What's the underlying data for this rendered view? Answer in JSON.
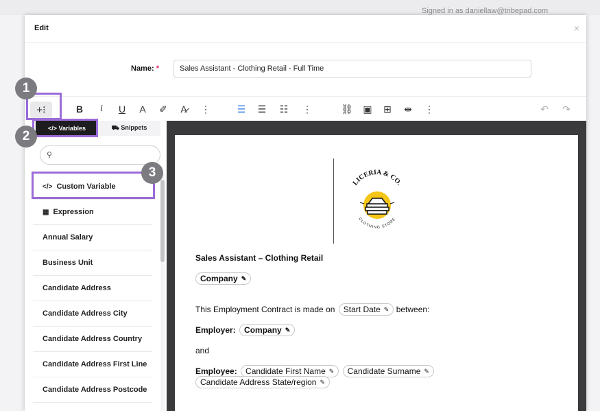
{
  "background": {
    "ghost_text": "Signed in as daniellaw@tribepad.com"
  },
  "modal": {
    "title": "Edit",
    "close_glyph": "×"
  },
  "form": {
    "name_label": "Name:",
    "required_mark": "*",
    "name_value": "Sales Assistant - Clothing Retail - Full Time"
  },
  "toolbar": {
    "insert": "+⁝",
    "bold": "B",
    "italic": "i",
    "underline": "U",
    "text_color": "A",
    "highlight": "✐",
    "clear_format": "A̷",
    "more1": "⋮",
    "align_left": "☰",
    "align_center": "☰",
    "list": "☷",
    "more2": "⋮",
    "link": "⛓",
    "image": "▣",
    "table": "⊞",
    "columns": "⇹",
    "more3": "⋮",
    "undo": "↶",
    "redo": "↷"
  },
  "sidebar": {
    "tabs": [
      {
        "label": "</> Variables"
      },
      {
        "label": "⛟ Snippets"
      }
    ],
    "search_icon": "search-icon",
    "search_glyph": "⚲",
    "items": [
      {
        "icon": "</>",
        "label": "Custom Variable"
      },
      {
        "icon": "▦",
        "label": "Expression"
      },
      {
        "icon": "",
        "label": "Annual Salary"
      },
      {
        "icon": "",
        "label": "Business Unit"
      },
      {
        "icon": "",
        "label": "Candidate Address"
      },
      {
        "icon": "",
        "label": "Candidate Address City"
      },
      {
        "icon": "",
        "label": "Candidate Address Country"
      },
      {
        "icon": "",
        "label": "Candidate Address First Line"
      },
      {
        "icon": "",
        "label": "Candidate Address Postcode"
      }
    ]
  },
  "document": {
    "logo": {
      "arc_text": "LICERIA & CO.",
      "sub_text": "CLOTHING STORE"
    },
    "heading": "Sales Assistant – Clothing Retail",
    "company_chip": "Company",
    "contract_line_prefix": "This Employment Contract is made on",
    "start_date_chip": "Start Date",
    "contract_line_suffix": "between:",
    "employer_label": "Employer:",
    "employer_chip": "Company",
    "and_text": "and",
    "employee_label": "Employee:",
    "first_name_chip": "Candidate First Name",
    "surname_chip": "Candidate Surname",
    "state_chip": "Candidate Address State/region",
    "pen": "✎"
  },
  "callouts": {
    "one": "1",
    "two": "2",
    "three": "3"
  }
}
